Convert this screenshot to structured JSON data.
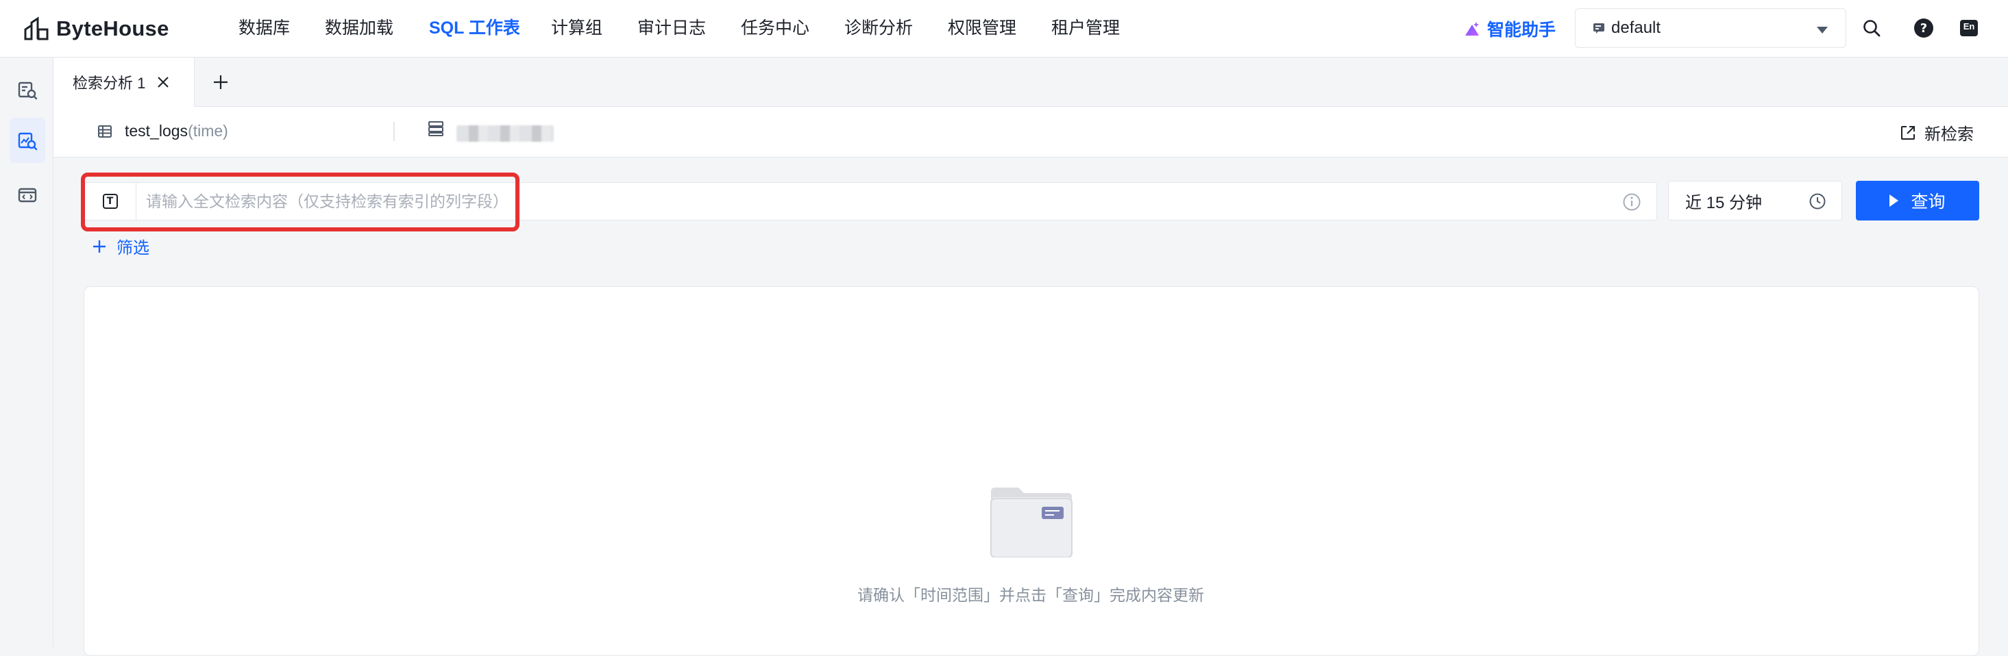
{
  "app": {
    "logo_text": "ByteHouse"
  },
  "nav": {
    "items": [
      {
        "label": "数据库",
        "active": false
      },
      {
        "label": "数据加载",
        "active": false
      },
      {
        "label": "SQL 工作表",
        "active": true
      },
      {
        "label": "计算组",
        "active": false
      },
      {
        "label": "审计日志",
        "active": false
      },
      {
        "label": "任务中心",
        "active": false
      },
      {
        "label": "诊断分析",
        "active": false
      },
      {
        "label": "权限管理",
        "active": false
      },
      {
        "label": "租户管理",
        "active": false
      }
    ],
    "assistant_label": "智能助手",
    "database_value": "default",
    "language_label": "En"
  },
  "tabs": {
    "items": [
      {
        "label": "检索分析 1",
        "active": true
      }
    ]
  },
  "source": {
    "table_name": "test_logs",
    "time_field": "(time)",
    "new_search_label": "新检索"
  },
  "search": {
    "type_icon_letter": "T",
    "placeholder": "请输入全文检索内容（仅支持检索有索引的列字段）",
    "value": "",
    "time_range": "近 15 分钟",
    "query_label": "查询",
    "filter_label": "筛选"
  },
  "empty_state": {
    "message": "请确认「时间范围」并点击「查询」完成内容更新"
  },
  "colors": {
    "accent": "#1664ff",
    "highlight": "#e63131",
    "assistant_gradient": [
      "#6a5cff",
      "#c65cff"
    ]
  }
}
